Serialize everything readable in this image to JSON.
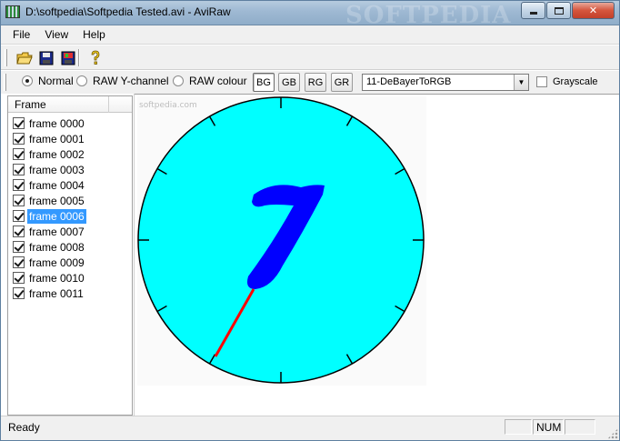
{
  "window": {
    "title": "D:\\softpedia\\Softpedia Tested.avi - AviRaw",
    "watermark": "SOFTPEDIA",
    "minimize_icon": "minimize-icon",
    "maximize_icon": "maximize-icon",
    "close_icon": "close-icon"
  },
  "menu": {
    "items": [
      {
        "label": "File"
      },
      {
        "label": "View"
      },
      {
        "label": "Help"
      }
    ]
  },
  "toolbar": {
    "buttons": [
      {
        "icon": "open-folder-icon"
      },
      {
        "icon": "save-icon"
      },
      {
        "icon": "save-frame-icon"
      },
      {
        "icon": "help-icon"
      }
    ]
  },
  "options": {
    "modes": [
      {
        "label": "Normal",
        "selected": true
      },
      {
        "label": "RAW Y-channel",
        "selected": false
      },
      {
        "label": "RAW colour",
        "selected": false
      }
    ],
    "bayer_buttons": [
      {
        "label": "BG",
        "pressed": true
      },
      {
        "label": "GB",
        "pressed": false
      },
      {
        "label": "RG",
        "pressed": false
      },
      {
        "label": "GR",
        "pressed": false
      }
    ],
    "debayer_method": "11-DeBayerToRGB",
    "grayscale_label": "Grayscale",
    "grayscale_checked": false
  },
  "frame_list": {
    "header": "Frame",
    "selected_index": 6,
    "items": [
      {
        "label": "frame 0000",
        "checked": true
      },
      {
        "label": "frame 0001",
        "checked": true
      },
      {
        "label": "frame 0002",
        "checked": true
      },
      {
        "label": "frame 0003",
        "checked": true
      },
      {
        "label": "frame 0004",
        "checked": true
      },
      {
        "label": "frame 0005",
        "checked": true
      },
      {
        "label": "frame 0006",
        "checked": true
      },
      {
        "label": "frame 0007",
        "checked": true
      },
      {
        "label": "frame 0008",
        "checked": true
      },
      {
        "label": "frame 0009",
        "checked": true
      },
      {
        "label": "frame 0010",
        "checked": true
      },
      {
        "label": "frame 0011",
        "checked": true
      }
    ]
  },
  "preview": {
    "overlay_text": "softpedia.com",
    "frame_number": "7",
    "dial_color": "#00ffff",
    "digit_color": "#0000ff",
    "hand_color": "#ff0000"
  },
  "status": {
    "text": "Ready",
    "num": "NUM"
  }
}
